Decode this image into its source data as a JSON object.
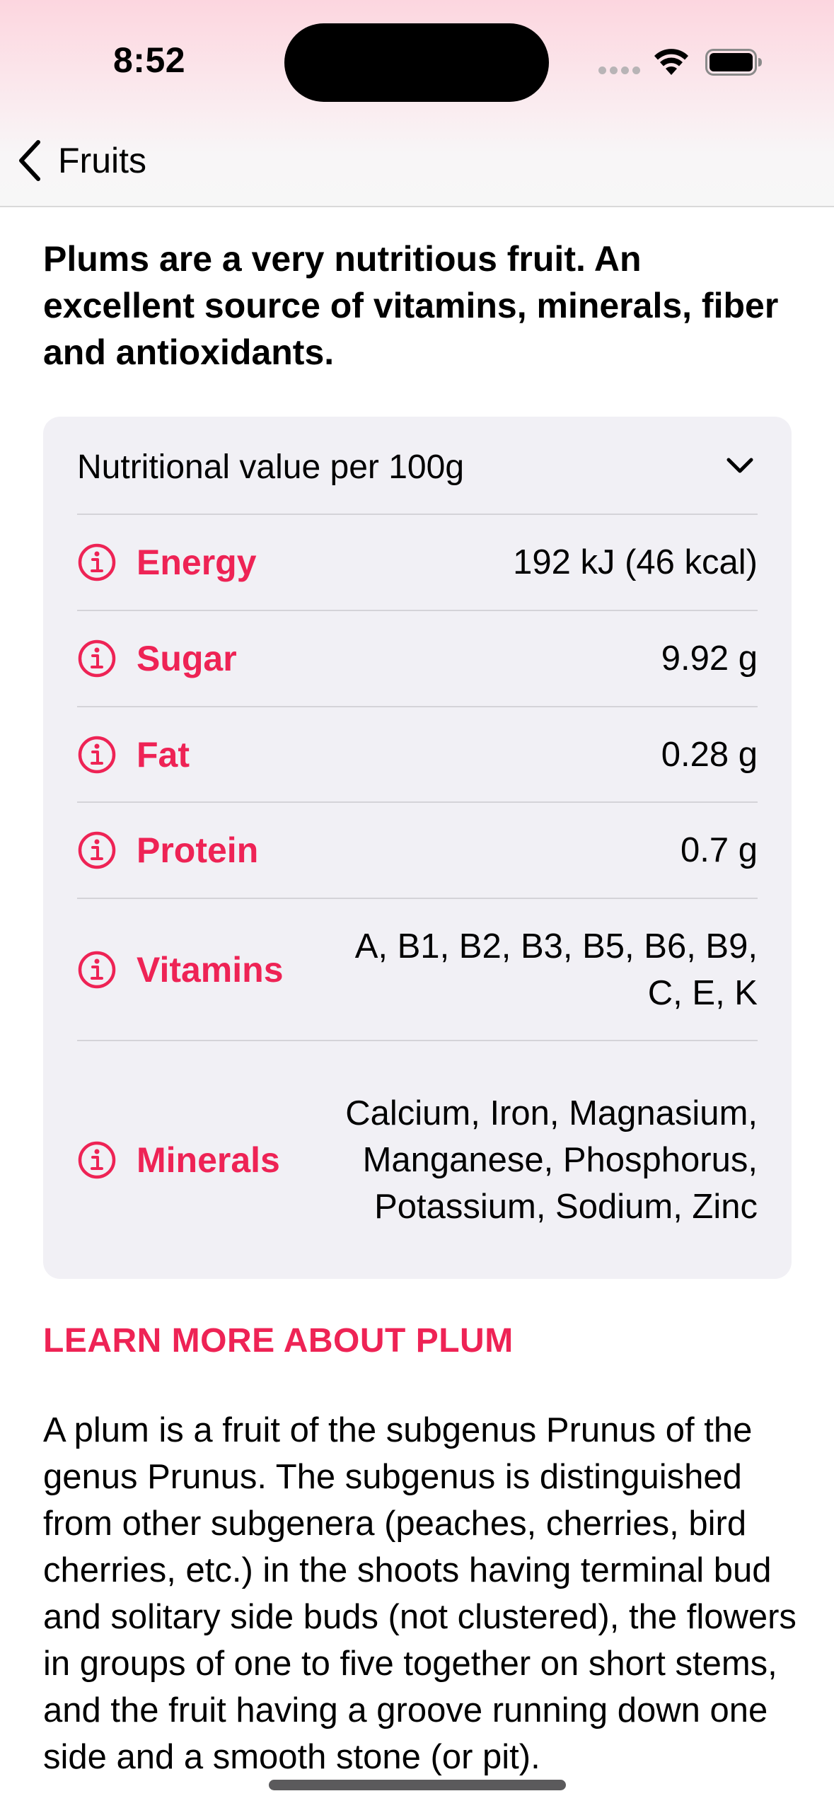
{
  "status_bar": {
    "time": "8:52"
  },
  "nav": {
    "back_label": "Fruits"
  },
  "intro": "Plums are a very nutritious fruit. An excellent source of vitamins, minerals, fiber and antioxidants.",
  "nutrition": {
    "title": "Nutritional value per 100g",
    "rows": [
      {
        "label": "Energy",
        "value": "192 kJ (46 kcal)"
      },
      {
        "label": "Sugar",
        "value": "9.92 g"
      },
      {
        "label": "Fat",
        "value": "0.28 g"
      },
      {
        "label": "Protein",
        "value": "0.7 g"
      },
      {
        "label": "Vitamins",
        "value": "A, B1, B2, B3, B5, B6, B9, C, E, K"
      },
      {
        "label": "Minerals",
        "value": "Calcium, Iron, Magnasium, Manganese, Phosphorus, Potassium, Sodium, Zinc"
      }
    ]
  },
  "learn_more": {
    "heading": "LEARN MORE ABOUT PLUM",
    "text": "A plum is a fruit of the subgenus Prunus of the genus Prunus. The subgenus is distinguished from other subgenera (peaches, cherries, bird cherries, etc.) in the shoots having terminal bud and solitary side buds (not clustered), the flowers in groups of one to five together on short stems, and the fruit having a groove running down one side and a smooth stone (or pit)."
  },
  "icons": {
    "back": "chevron-left-icon",
    "expand": "chevron-down-icon",
    "info": "info-circle-icon",
    "wifi": "wifi-icon",
    "battery": "battery-icon"
  },
  "colors": {
    "accent": "#ee2355",
    "card_background": "#f1f0f5",
    "header_gradient_top": "#fcd6df"
  }
}
